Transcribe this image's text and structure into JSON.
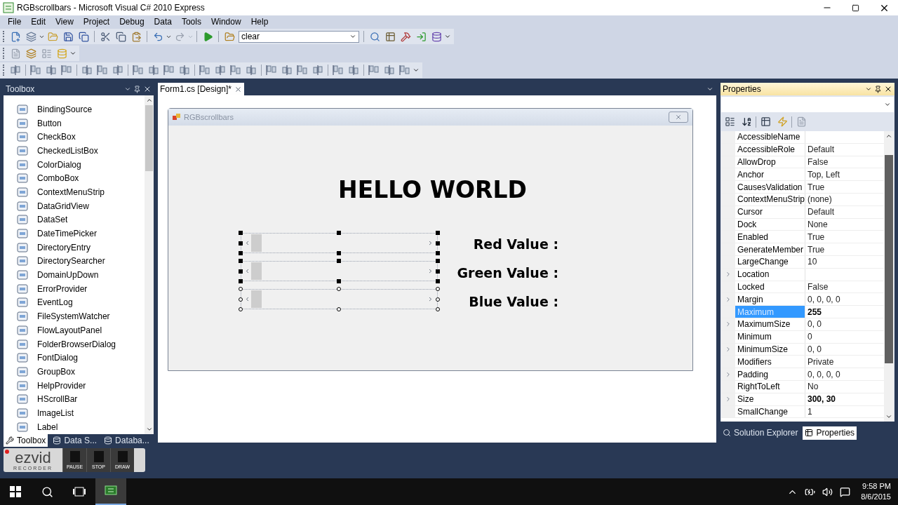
{
  "window": {
    "title": "RGBscrollbars - Microsoft Visual C# 2010 Express"
  },
  "menu": [
    "File",
    "Edit",
    "View",
    "Project",
    "Debug",
    "Data",
    "Tools",
    "Window",
    "Help"
  ],
  "toolbar": {
    "solution_config": "clear"
  },
  "toolbox": {
    "title": "Toolbox",
    "items": [
      {
        "label": "BindingSource"
      },
      {
        "label": "Button"
      },
      {
        "label": "CheckBox"
      },
      {
        "label": "CheckedListBox"
      },
      {
        "label": "ColorDialog"
      },
      {
        "label": "ComboBox"
      },
      {
        "label": "ContextMenuStrip"
      },
      {
        "label": "DataGridView"
      },
      {
        "label": "DataSet"
      },
      {
        "label": "DateTimePicker"
      },
      {
        "label": "DirectoryEntry"
      },
      {
        "label": "DirectorySearcher"
      },
      {
        "label": "DomainUpDown"
      },
      {
        "label": "ErrorProvider"
      },
      {
        "label": "EventLog"
      },
      {
        "label": "FileSystemWatcher"
      },
      {
        "label": "FlowLayoutPanel"
      },
      {
        "label": "FolderBrowserDialog"
      },
      {
        "label": "FontDialog"
      },
      {
        "label": "GroupBox"
      },
      {
        "label": "HelpProvider"
      },
      {
        "label": "HScrollBar"
      },
      {
        "label": "ImageList"
      },
      {
        "label": "Label"
      }
    ],
    "tabs": [
      {
        "label": "Toolbox",
        "selected": true
      },
      {
        "label": "Data S...",
        "selected": false
      },
      {
        "label": "Databa...",
        "selected": false
      }
    ]
  },
  "document_tabs": [
    {
      "label": "Form1.cs [Design]*",
      "selected": true
    }
  ],
  "form": {
    "title": "RGBscrollbars",
    "heading": "HELLO WORLD",
    "scrollbars": [
      {
        "primary": false
      },
      {
        "primary": false
      },
      {
        "primary": true
      }
    ],
    "labels": [
      "Red Value :",
      "Green Value :",
      "Blue Value :"
    ]
  },
  "properties": {
    "title": "Properties",
    "rows": [
      {
        "name": "AccessibleName",
        "value": "",
        "expandable": false,
        "selected": false
      },
      {
        "name": "AccessibleRole",
        "value": "Default",
        "expandable": false,
        "selected": false,
        "bold": false
      },
      {
        "name": "AllowDrop",
        "value": "False",
        "expandable": false,
        "selected": false,
        "bold": false
      },
      {
        "name": "Anchor",
        "value": "Top, Left",
        "expandable": false,
        "selected": false,
        "bold": false
      },
      {
        "name": "CausesValidation",
        "value": "True",
        "expandable": false,
        "selected": false,
        "bold": false
      },
      {
        "name": "ContextMenuStrip",
        "value": "(none)",
        "expandable": false,
        "selected": false,
        "bold": false
      },
      {
        "name": "Cursor",
        "value": "Default",
        "expandable": false,
        "selected": false,
        "bold": false
      },
      {
        "name": "Dock",
        "value": "None",
        "expandable": false,
        "selected": false,
        "bold": false
      },
      {
        "name": "Enabled",
        "value": "True",
        "expandable": false,
        "selected": false,
        "bold": false
      },
      {
        "name": "GenerateMember",
        "value": "True",
        "expandable": false,
        "selected": false,
        "bold": false
      },
      {
        "name": "LargeChange",
        "value": "10",
        "expandable": false,
        "selected": false,
        "bold": false
      },
      {
        "name": "Location",
        "value": "",
        "expandable": true,
        "selected": false
      },
      {
        "name": "Locked",
        "value": "False",
        "expandable": false,
        "selected": false,
        "bold": false
      },
      {
        "name": "Margin",
        "value": "0, 0, 0, 0",
        "expandable": true,
        "selected": false,
        "bold": false
      },
      {
        "name": "Maximum",
        "value": "255",
        "expandable": false,
        "selected": true,
        "bold": true
      },
      {
        "name": "MaximumSize",
        "value": "0, 0",
        "expandable": true,
        "selected": false,
        "bold": false
      },
      {
        "name": "Minimum",
        "value": "0",
        "expandable": false,
        "selected": false,
        "bold": false
      },
      {
        "name": "MinimumSize",
        "value": "0, 0",
        "expandable": true,
        "selected": false,
        "bold": false
      },
      {
        "name": "Modifiers",
        "value": "Private",
        "expandable": false,
        "selected": false,
        "bold": false
      },
      {
        "name": "Padding",
        "value": "0, 0, 0, 0",
        "expandable": true,
        "selected": false,
        "bold": false
      },
      {
        "name": "RightToLeft",
        "value": "No",
        "expandable": false,
        "selected": false,
        "bold": false
      },
      {
        "name": "Size",
        "value": "300, 30",
        "expandable": true,
        "selected": false,
        "bold": true
      },
      {
        "name": "SmallChange",
        "value": "1",
        "expandable": false,
        "selected": false,
        "bold": false
      }
    ],
    "tabs": [
      {
        "label": "Solution Explorer",
        "selected": false
      },
      {
        "label": "Properties",
        "selected": true
      }
    ]
  },
  "recorder": {
    "brand": "ezvid",
    "subtitle": "RECORDER",
    "buttons": [
      "PAUSE",
      "STOP",
      "DRAW"
    ]
  },
  "taskbar": {
    "time": "9:58 PM",
    "date": "8/6/2015"
  }
}
